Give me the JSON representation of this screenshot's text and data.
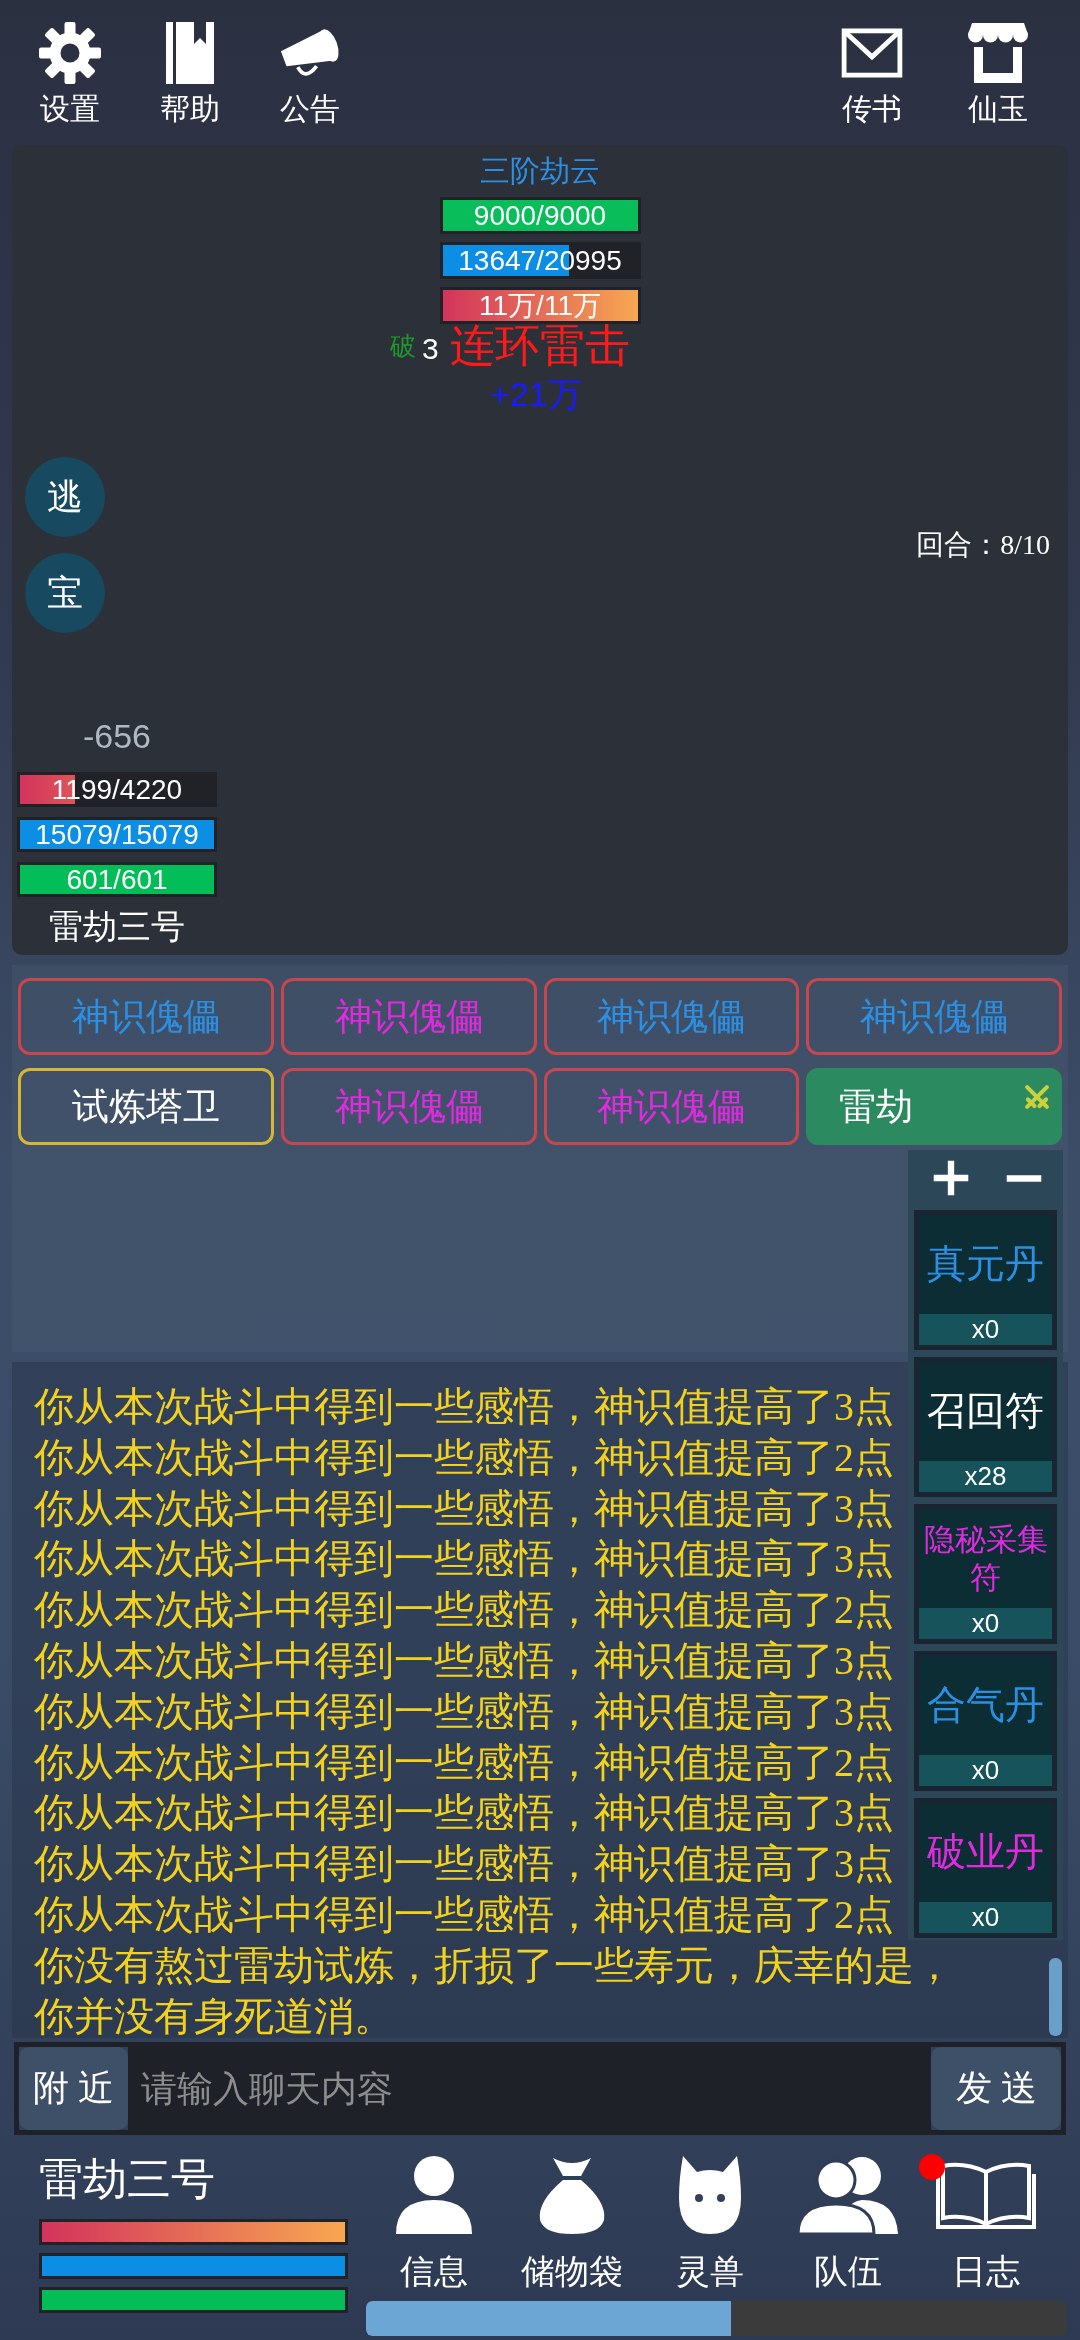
{
  "top_bar": {
    "left": [
      {
        "label": "设置"
      },
      {
        "label": "帮助"
      },
      {
        "label": "公告"
      }
    ],
    "right": [
      {
        "label": "传书"
      },
      {
        "label": "仙玉"
      }
    ]
  },
  "battle": {
    "enemy": {
      "name": "三阶劫云",
      "bars": [
        {
          "text": "9000/9000",
          "level": 1,
          "kind": "solid",
          "color": "#08bd5a"
        },
        {
          "text": "13647/20995",
          "level": 0.65,
          "kind": "solid",
          "color": "#0b8ee3"
        },
        {
          "text": "11万/11万",
          "level": 1,
          "kind": "gradient",
          "color": "#d3345c"
        }
      ]
    },
    "combat_texts": [
      {
        "text": "破",
        "color": "#1f9a2a"
      },
      {
        "text": "3",
        "color": "#ffffff"
      },
      {
        "text": "连环雷击",
        "color": "#ff1a1a"
      },
      {
        "text": "+21万",
        "color": "#1a1aff"
      }
    ],
    "actions": [
      {
        "label": "逃"
      },
      {
        "label": "宝"
      }
    ],
    "round": "回合：8/10",
    "player": {
      "damage": "-656",
      "bars": [
        {
          "text": "1199/4220",
          "level": 0.284,
          "kind": "gradient",
          "color": "#d3345c"
        },
        {
          "text": "15079/15079",
          "level": 1,
          "kind": "solid",
          "color": "#0b8ee3"
        },
        {
          "text": "601/601",
          "level": 1,
          "kind": "solid",
          "color": "#03bd58"
        }
      ],
      "name": "雷劫三号"
    }
  },
  "targets": [
    {
      "label": "神识傀儡",
      "color": "#2b8fe3",
      "selected": false,
      "kind": "enemy"
    },
    {
      "label": "神识傀儡",
      "color": "#e02ae0",
      "selected": false,
      "kind": "enemy"
    },
    {
      "label": "神识傀儡",
      "color": "#2b8fe3",
      "selected": false,
      "kind": "enemy"
    },
    {
      "label": "神识傀儡",
      "color": "#2b8fe3",
      "selected": false,
      "kind": "enemy"
    },
    {
      "label": "试炼塔卫",
      "color": "#ffffff",
      "selected": true,
      "kind": "enemy"
    },
    {
      "label": "神识傀儡",
      "color": "#e02ae0",
      "selected": false,
      "kind": "enemy"
    },
    {
      "label": "神识傀儡",
      "color": "#e02ae0",
      "selected": false,
      "kind": "enemy"
    },
    {
      "label": "雷劫",
      "selected": false,
      "kind": "self"
    }
  ],
  "quick_items": [
    {
      "name": "真元丹",
      "color": "#2b8fe3",
      "count": "x0"
    },
    {
      "name": "召回符",
      "color": "#ffffff",
      "count": "x28"
    },
    {
      "name": "隐秘采集符",
      "color": "#e02ae0",
      "count": "x0"
    },
    {
      "name": "合气丹",
      "color": "#2b8fe3",
      "count": "x0"
    },
    {
      "name": "破业丹",
      "color": "#e02ae0",
      "count": "x0"
    }
  ],
  "chat_log": [
    "你从本次战斗中得到一些感悟，神识值提高了3点",
    "你从本次战斗中得到一些感悟，神识值提高了2点",
    "你从本次战斗中得到一些感悟，神识值提高了3点",
    "你从本次战斗中得到一些感悟，神识值提高了3点",
    "你从本次战斗中得到一些感悟，神识值提高了2点",
    "你从本次战斗中得到一些感悟，神识值提高了3点",
    "你从本次战斗中得到一些感悟，神识值提高了3点",
    "你从本次战斗中得到一些感悟，神识值提高了2点",
    "你从本次战斗中得到一些感悟，神识值提高了3点",
    "你从本次战斗中得到一些感悟，神识值提高了3点",
    "你从本次战斗中得到一些感悟，神识值提高了2点",
    "你没有熬过雷劫试炼，折损了一些寿元，庆幸的是，你并没有身死道消。"
  ],
  "chat_bar": {
    "channel": "附 近",
    "placeholder": "请输入聊天内容",
    "send": "发 送"
  },
  "status": {
    "name": "雷劫三号",
    "bars": [
      {
        "level": 1,
        "kind": "gradient",
        "color": "#d3345c"
      },
      {
        "level": 1,
        "kind": "solid",
        "color": "#0b8ee3"
      },
      {
        "level": 1,
        "kind": "solid",
        "color": "#03bd58"
      }
    ]
  },
  "nav": [
    {
      "label": "信息",
      "notification": false
    },
    {
      "label": "储物袋",
      "notification": false
    },
    {
      "label": "灵兽",
      "notification": false
    },
    {
      "label": "队伍",
      "notification": false
    },
    {
      "label": "日志",
      "notification": true
    }
  ],
  "progress": {
    "level": 0.52
  }
}
